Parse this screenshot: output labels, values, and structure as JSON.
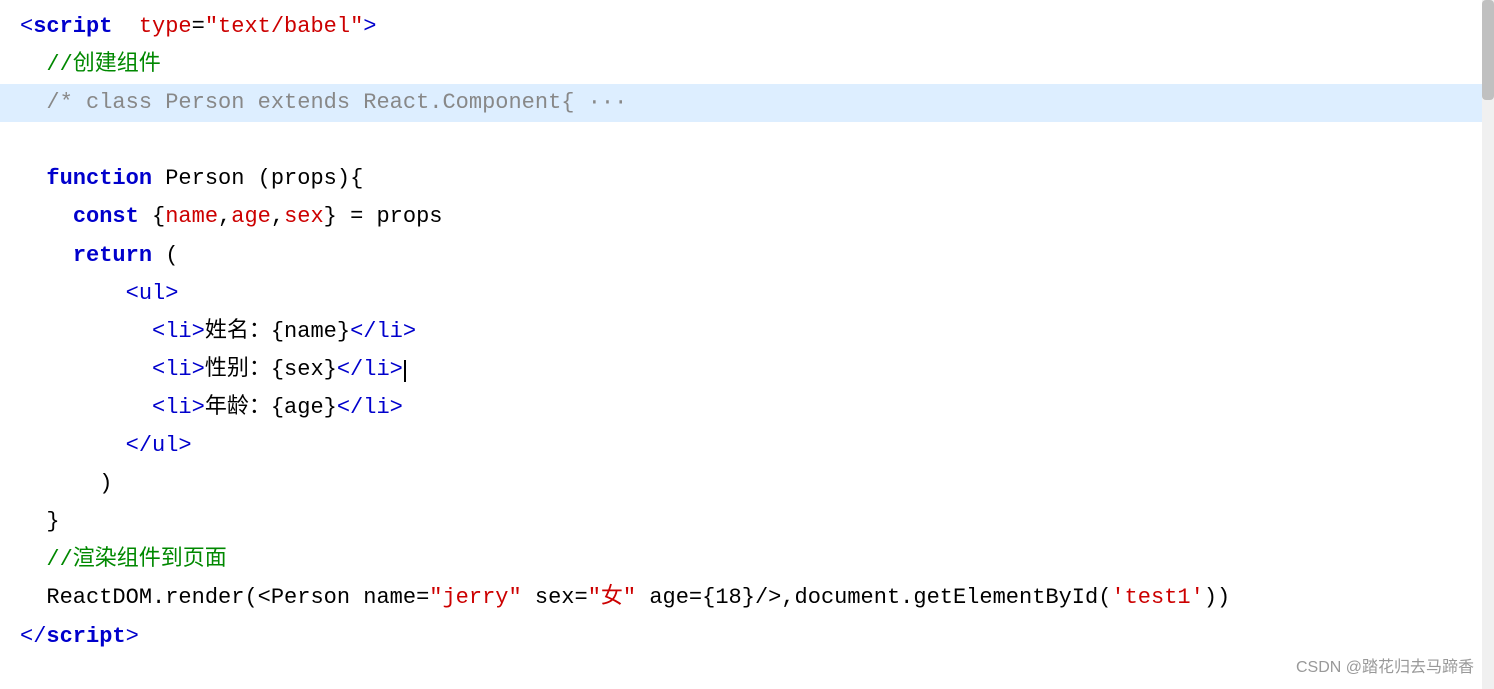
{
  "code": {
    "lines": [
      {
        "id": "line1",
        "highlighted": false,
        "parts": [
          {
            "text": "<",
            "color": "tag"
          },
          {
            "text": "script",
            "color": "keyword"
          },
          {
            "text": " ",
            "color": "plain"
          },
          {
            "text": "type",
            "color": "attr-name"
          },
          {
            "text": "=",
            "color": "plain"
          },
          {
            "text": "\"text/babel\"",
            "color": "string"
          },
          {
            "text": ">",
            "color": "tag"
          }
        ]
      },
      {
        "id": "line2",
        "highlighted": false,
        "parts": [
          {
            "text": "  //创建组件",
            "color": "comment"
          }
        ]
      },
      {
        "id": "line3",
        "highlighted": true,
        "parts": [
          {
            "text": "  /* class Person extends React.Component{ ···",
            "color": "comment-block"
          }
        ]
      },
      {
        "id": "line4",
        "highlighted": false,
        "parts": [
          {
            "text": "",
            "color": "plain"
          }
        ]
      },
      {
        "id": "line5",
        "highlighted": false,
        "parts": [
          {
            "text": "  ",
            "color": "plain"
          },
          {
            "text": "function",
            "color": "keyword"
          },
          {
            "text": " Person (props){",
            "color": "plain"
          }
        ]
      },
      {
        "id": "line6",
        "highlighted": false,
        "parts": [
          {
            "text": "    ",
            "color": "plain"
          },
          {
            "text": "const",
            "color": "keyword"
          },
          {
            "text": " {",
            "color": "plain"
          },
          {
            "text": "name",
            "color": "attr-name"
          },
          {
            "text": ",",
            "color": "plain"
          },
          {
            "text": "age",
            "color": "attr-name"
          },
          {
            "text": ",",
            "color": "plain"
          },
          {
            "text": "sex",
            "color": "attr-name"
          },
          {
            "text": "} = props",
            "color": "plain"
          }
        ]
      },
      {
        "id": "line7",
        "highlighted": false,
        "parts": [
          {
            "text": "    ",
            "color": "plain"
          },
          {
            "text": "return",
            "color": "keyword"
          },
          {
            "text": " (",
            "color": "plain"
          }
        ]
      },
      {
        "id": "line8",
        "highlighted": false,
        "parts": [
          {
            "text": "        ",
            "color": "plain"
          },
          {
            "text": "<ul>",
            "color": "tag"
          }
        ]
      },
      {
        "id": "line9",
        "highlighted": false,
        "parts": [
          {
            "text": "          ",
            "color": "plain"
          },
          {
            "text": "<li>",
            "color": "tag"
          },
          {
            "text": "姓名：{name}",
            "color": "plain"
          },
          {
            "text": "</li>",
            "color": "tag"
          }
        ]
      },
      {
        "id": "line10",
        "highlighted": false,
        "parts": [
          {
            "text": "          ",
            "color": "plain"
          },
          {
            "text": "<li>",
            "color": "tag"
          },
          {
            "text": "性别：{sex}",
            "color": "plain"
          },
          {
            "text": "</li>",
            "color": "tag"
          },
          {
            "text": "|cursor|",
            "color": "plain"
          }
        ]
      },
      {
        "id": "line11",
        "highlighted": false,
        "parts": [
          {
            "text": "          ",
            "color": "plain"
          },
          {
            "text": "<li>",
            "color": "tag"
          },
          {
            "text": "年龄：{age}",
            "color": "plain"
          },
          {
            "text": "</li>",
            "color": "tag"
          }
        ]
      },
      {
        "id": "line12",
        "highlighted": false,
        "parts": [
          {
            "text": "        ",
            "color": "plain"
          },
          {
            "text": "</ul>",
            "color": "tag"
          }
        ]
      },
      {
        "id": "line13",
        "highlighted": false,
        "parts": [
          {
            "text": "      )",
            "color": "plain"
          }
        ]
      },
      {
        "id": "line14",
        "highlighted": false,
        "parts": [
          {
            "text": "  }",
            "color": "plain"
          }
        ]
      },
      {
        "id": "line15",
        "highlighted": false,
        "parts": [
          {
            "text": "  //渲染组件到页面",
            "color": "comment"
          }
        ]
      },
      {
        "id": "line16",
        "highlighted": false,
        "parts": [
          {
            "text": "  ReactDOM.render(<Person name=",
            "color": "plain"
          },
          {
            "text": "\"jerry\"",
            "color": "string"
          },
          {
            "text": " sex=",
            "color": "plain"
          },
          {
            "text": "\"",
            "color": "string"
          },
          {
            "text": "女",
            "color": "string"
          },
          {
            "text": "\"",
            "color": "string"
          },
          {
            "text": " age={18}/>,document.getElementById(",
            "color": "plain"
          },
          {
            "text": "'test1'",
            "color": "string"
          },
          {
            "text": "))",
            "color": "plain"
          }
        ]
      },
      {
        "id": "line17",
        "highlighted": false,
        "parts": [
          {
            "text": "</",
            "color": "tag"
          },
          {
            "text": "script",
            "color": "keyword"
          },
          {
            "text": ">",
            "color": "tag"
          }
        ]
      }
    ]
  },
  "watermark": "CSDN @踏花归去马蹄香"
}
